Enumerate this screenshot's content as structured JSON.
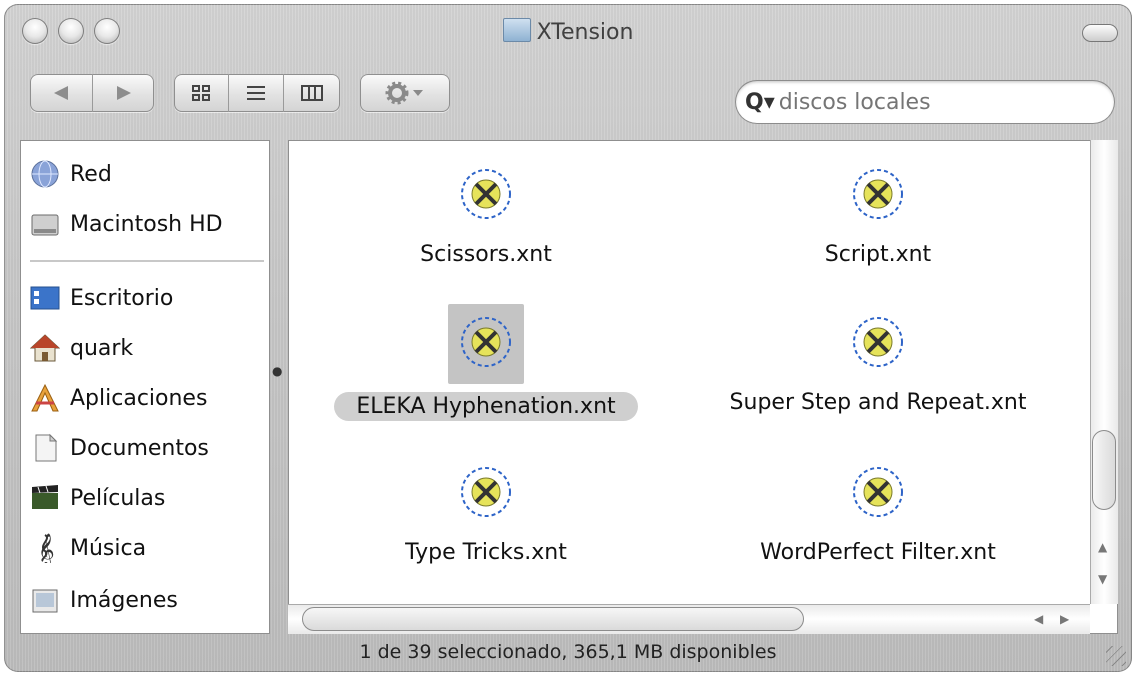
{
  "window": {
    "title": "XTension",
    "colors": {
      "selection": "#cfcfcf",
      "metal": "#c8c8c8"
    }
  },
  "toolbar": {
    "back_icon": "back-arrow-icon",
    "forward_icon": "forward-arrow-icon",
    "view_icons": [
      "icon-view-icon",
      "list-view-icon",
      "column-view-icon"
    ],
    "action_icon": "gear-icon"
  },
  "search": {
    "placeholder": "discos locales"
  },
  "sidebar": {
    "devices": [
      {
        "label": "Red",
        "icon": "network-globe-icon"
      },
      {
        "label": "Macintosh HD",
        "icon": "hard-disk-icon"
      }
    ],
    "places": [
      {
        "label": "Escritorio",
        "icon": "desktop-icon"
      },
      {
        "label": "quark",
        "icon": "home-icon"
      },
      {
        "label": "Aplicaciones",
        "icon": "applications-icon"
      },
      {
        "label": "Documentos",
        "icon": "documents-icon"
      },
      {
        "label": "Películas",
        "icon": "movies-icon"
      },
      {
        "label": "Música",
        "icon": "music-icon"
      },
      {
        "label": "Imágenes",
        "icon": "pictures-icon"
      }
    ]
  },
  "files": [
    {
      "name": "Scissors.xnt",
      "selected": false
    },
    {
      "name": "Script.xnt",
      "selected": false
    },
    {
      "name": "ELEKA Hyphenation.xnt",
      "selected": true
    },
    {
      "name": "Super Step and Repeat.xnt",
      "selected": false
    },
    {
      "name": "Type Tricks.xnt",
      "selected": false
    },
    {
      "name": "WordPerfect Filter.xnt",
      "selected": false
    }
  ],
  "status": "1 de 39 seleccionado, 365,1 MB disponibles"
}
